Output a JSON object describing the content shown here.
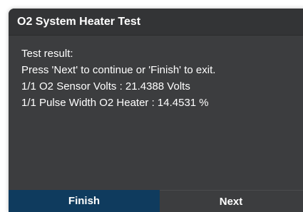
{
  "dialog": {
    "title": "O2 System Heater Test",
    "lines": [
      "Test result:",
      "Press 'Next' to continue or 'Finish' to exit.",
      "1/1 O2 Sensor Volts : 21.4388 Volts",
      "1/1 Pulse Width O2 Heater : 14.4531 %"
    ],
    "buttons": {
      "finish": "Finish",
      "next": "Next"
    }
  },
  "colors": {
    "background": "#3c3d3f",
    "title_bar": "#333436",
    "finish_button": "#0f3b5e",
    "text": "#ffffff"
  }
}
